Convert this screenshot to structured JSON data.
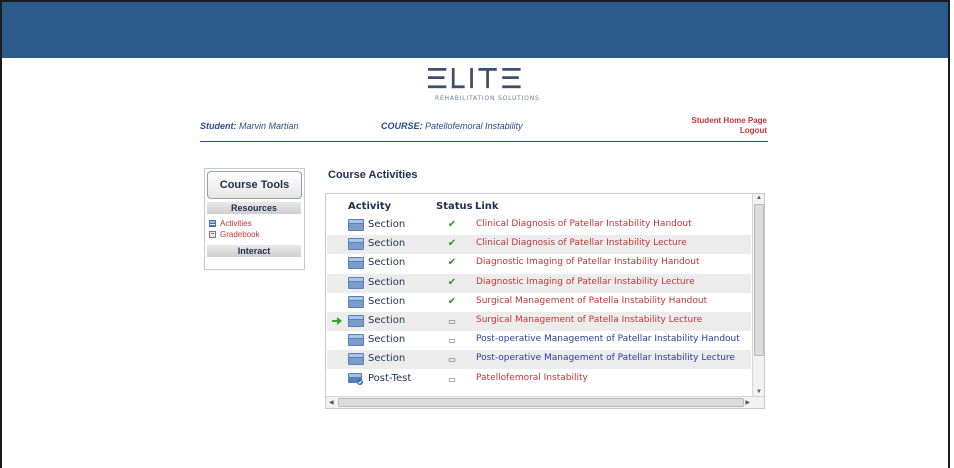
{
  "logo": {
    "wordmark": "ELITE",
    "tagline": "REHABILITATION SOLUTIONS"
  },
  "header": {
    "student_label": "Student:",
    "student_name": "Marvin Martian",
    "course_label": "COURSE:",
    "course_name": "Patellofemoral Instability",
    "home_link": "Student Home Page",
    "logout_link": "Logout"
  },
  "tools": {
    "button": "Course Tools",
    "resources_heading": "Resources",
    "items": [
      {
        "label": "Activities",
        "icon": "list-icon"
      },
      {
        "label": "Gradebook",
        "icon": "gradebook-icon"
      }
    ],
    "interact_heading": "Interact"
  },
  "activities": {
    "title": "Course Activities",
    "columns": [
      "Activity",
      "Status",
      "Link"
    ],
    "rows": [
      {
        "activity": "Section",
        "status": "✔",
        "done": true,
        "link": "Clinical Diagnosis of Patellar Instability Handout",
        "current": false
      },
      {
        "activity": "Section",
        "status": "✔",
        "done": true,
        "link": "Clinical Diagnosis of Patellar Instability Lecture",
        "current": false
      },
      {
        "activity": "Section",
        "status": "✔",
        "done": true,
        "link": "Diagnostic Imaging of Patellar Instability Handout",
        "current": false
      },
      {
        "activity": "Section",
        "status": "✔",
        "done": true,
        "link": "Diagnostic Imaging of Patellar Instability Lecture",
        "current": false
      },
      {
        "activity": "Section",
        "status": "✔",
        "done": true,
        "link": "Surgical Management of Patella Instability Handout",
        "current": false
      },
      {
        "activity": "Section",
        "status": "▭",
        "done": false,
        "link": "Surgical Management of Patella Instability Lecture",
        "current": true
      },
      {
        "activity": "Section",
        "status": "▭",
        "done": false,
        "link": "Post-operative Management of Patellar Instability Handout",
        "current": false
      },
      {
        "activity": "Section",
        "status": "▭",
        "done": false,
        "link": "Post-operative Management of Patellar Instability Lecture",
        "current": false
      },
      {
        "activity": "Post-Test",
        "status": "▭",
        "done": false,
        "link": "Patellofemoral Instability",
        "current": false
      }
    ]
  },
  "colors": {
    "band": "#2b5b8a",
    "link_red": "#c23535",
    "link_blue": "#2a3f9a",
    "check_green": "#3b8e2b",
    "arrow_green": "#3aa03a"
  }
}
